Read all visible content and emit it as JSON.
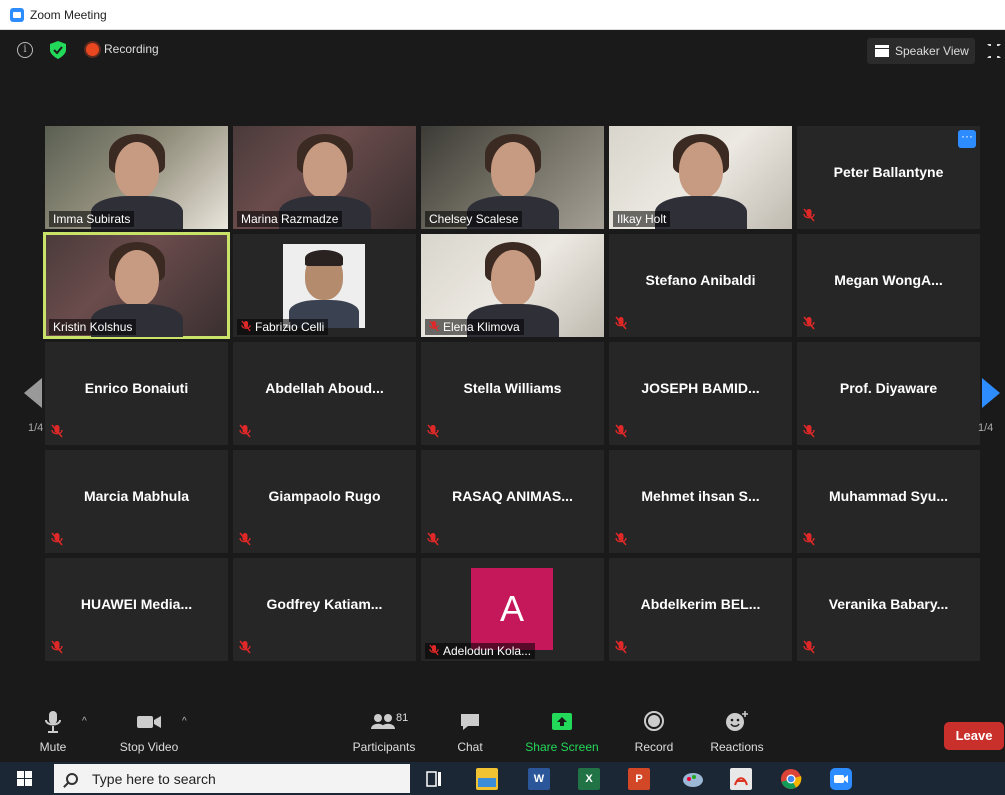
{
  "window": {
    "title": "Zoom Meeting"
  },
  "topbar": {
    "recording_label": "Recording",
    "view_label": "Speaker View"
  },
  "tiles": {
    "r1": [
      {
        "name": "Imma Subirats",
        "kind": "video",
        "muted": false,
        "active": false
      },
      {
        "name": "Marina Razmadze",
        "kind": "video",
        "muted": false,
        "active": false
      },
      {
        "name": "Chelsey Scalese",
        "kind": "video",
        "muted": false,
        "active": false
      },
      {
        "name": "Ilkay Holt",
        "kind": "video",
        "muted": false,
        "active": false
      },
      {
        "name": "Peter Ballantyne",
        "kind": "name",
        "muted": true,
        "active": false,
        "has_more": true
      }
    ],
    "r2": [
      {
        "name": "Kristin Kolshus",
        "kind": "video",
        "muted": false,
        "active": true
      },
      {
        "name": "Fabrizio Celli",
        "kind": "photo",
        "muted": true,
        "active": false
      },
      {
        "name": "Elena Klimova",
        "kind": "video",
        "muted": true,
        "active": false
      },
      {
        "name": "Stefano Anibaldi",
        "kind": "name",
        "muted": true,
        "active": false
      },
      {
        "name": "Megan WongA...",
        "kind": "name",
        "muted": true,
        "active": false
      }
    ],
    "r3": [
      {
        "name": "Enrico Bonaiuti",
        "kind": "name",
        "muted": true,
        "active": false
      },
      {
        "name": "Abdellah Aboud...",
        "kind": "name",
        "muted": true,
        "active": false
      },
      {
        "name": "Stella Williams",
        "kind": "name",
        "muted": true,
        "active": false
      },
      {
        "name": "JOSEPH BAMID...",
        "kind": "name",
        "muted": true,
        "active": false
      },
      {
        "name": "Prof. Diyaware",
        "kind": "name",
        "muted": true,
        "active": false
      }
    ],
    "r4": [
      {
        "name": "Marcia Mabhula",
        "kind": "name",
        "muted": true,
        "active": false
      },
      {
        "name": "Giampaolo Rugo",
        "kind": "name",
        "muted": true,
        "active": false
      },
      {
        "name": "RASAQ ANIMAS...",
        "kind": "name",
        "muted": true,
        "active": false
      },
      {
        "name": "Mehmet ihsan S...",
        "kind": "name",
        "muted": true,
        "active": false
      },
      {
        "name": "Muhammad Syu...",
        "kind": "name",
        "muted": true,
        "active": false
      }
    ],
    "r5": [
      {
        "name": "HUAWEI Media...",
        "kind": "name",
        "muted": true,
        "active": false
      },
      {
        "name": "Godfrey Katiam...",
        "kind": "name",
        "muted": true,
        "active": false
      },
      {
        "name": "Adelodun Kola...",
        "kind": "avatar",
        "avatar_letter": "A",
        "avatar_color": "#c4185a",
        "muted": true,
        "active": false
      },
      {
        "name": "Abdelkerim BEL...",
        "kind": "name",
        "muted": true,
        "active": false
      },
      {
        "name": "Veranika Babary...",
        "kind": "name",
        "muted": true,
        "active": false
      }
    ]
  },
  "pagination": {
    "left": "1/4",
    "right": "1/4"
  },
  "toolbar": {
    "mute": "Mute",
    "stop_video": "Stop Video",
    "participants": "Participants",
    "participants_count": "81",
    "chat": "Chat",
    "share_screen": "Share Screen",
    "record": "Record",
    "reactions": "Reactions",
    "leave": "Leave"
  },
  "taskbar": {
    "search_placeholder": "Type here to search"
  },
  "colors": {
    "accent": "#2d8cff",
    "share": "#23d959",
    "leave": "#c9302c",
    "active_speaker": "#c8e26a"
  }
}
